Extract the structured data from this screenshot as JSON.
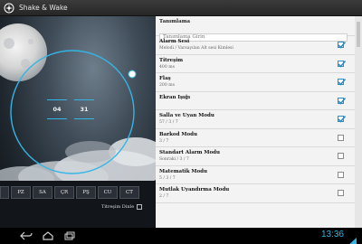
{
  "app": {
    "title": "Shake & Wake",
    "icon": "app-logo-icon"
  },
  "timepicker": {
    "hours": [
      "",
      "04",
      ""
    ],
    "minutes": [
      "",
      "31",
      ""
    ]
  },
  "days": [
    "",
    "PZ",
    "SA",
    "ÇR",
    "PŞ",
    "CU",
    "CT"
  ],
  "silent": {
    "label": "Titreşim Dinle",
    "checked": false
  },
  "form": {
    "label_title": "Tanımlama",
    "label_placeholder": "Tanımlama Girin"
  },
  "settings": [
    {
      "title": "Alarm Sesi",
      "subtitle": "Melodi / Varsayılan Alt sesi Kimlesi",
      "checked": true
    },
    {
      "title": "Titreşim",
      "subtitle": "400 ms",
      "checked": true
    },
    {
      "title": "Flaş",
      "subtitle": "200 ms",
      "checked": true
    },
    {
      "title": "Ekran Işığı",
      "subtitle": "",
      "checked": true
    },
    {
      "title": "Salla ve Uyan Modu",
      "subtitle": "57 / 3 / 7",
      "checked": true
    },
    {
      "title": "Barkod Modu",
      "subtitle": "3 / 7",
      "checked": false
    },
    {
      "title": "Standart Alarm Modu",
      "subtitle": "Sonraki / 3 / 7",
      "checked": false
    },
    {
      "title": "Matematik Modu",
      "subtitle": "5 / 3 / 7",
      "checked": false
    },
    {
      "title": "Mutlak Uyandırma Modu",
      "subtitle": "2 / 7",
      "checked": false
    }
  ],
  "status": {
    "time": "13:36"
  },
  "colors": {
    "accent": "#33b5e5",
    "check": "#2a8fc7"
  }
}
